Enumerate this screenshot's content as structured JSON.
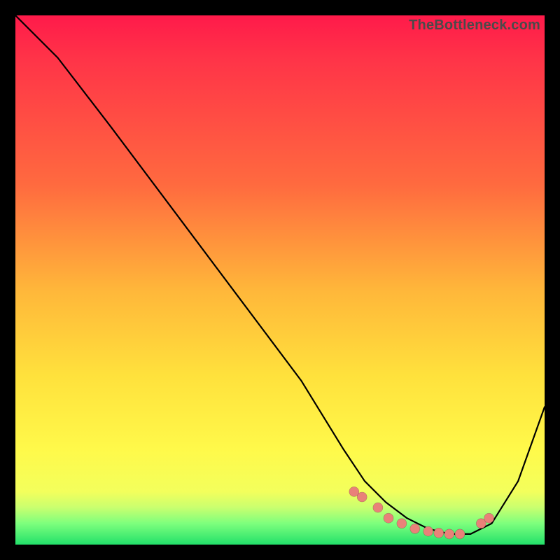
{
  "watermark": "TheBottleneck.com",
  "chart_data": {
    "type": "line",
    "title": "",
    "xlabel": "",
    "ylabel": "",
    "xlim": [
      0,
      100
    ],
    "ylim": [
      0,
      100
    ],
    "grid": false,
    "legend": false,
    "series": [
      {
        "name": "curve",
        "x": [
          0,
          8,
          18,
          30,
          42,
          54,
          62,
          66,
          70,
          74,
          78,
          82,
          86,
          90,
          95,
          100
        ],
        "y": [
          100,
          92,
          79,
          63,
          47,
          31,
          18,
          12,
          8,
          5,
          3,
          2,
          2,
          4,
          12,
          26
        ]
      }
    ],
    "markers": {
      "name": "dots",
      "x": [
        64,
        65.5,
        68.5,
        70.5,
        73,
        75.5,
        78,
        80,
        82,
        84,
        88,
        89.5
      ],
      "y": [
        10,
        9,
        7,
        5,
        4,
        3,
        2.5,
        2.2,
        2,
        2,
        4,
        5
      ]
    },
    "background_gradient": {
      "top": "#ff1a4a",
      "mid": "#ffe13c",
      "bottom": "#22e06a"
    }
  }
}
